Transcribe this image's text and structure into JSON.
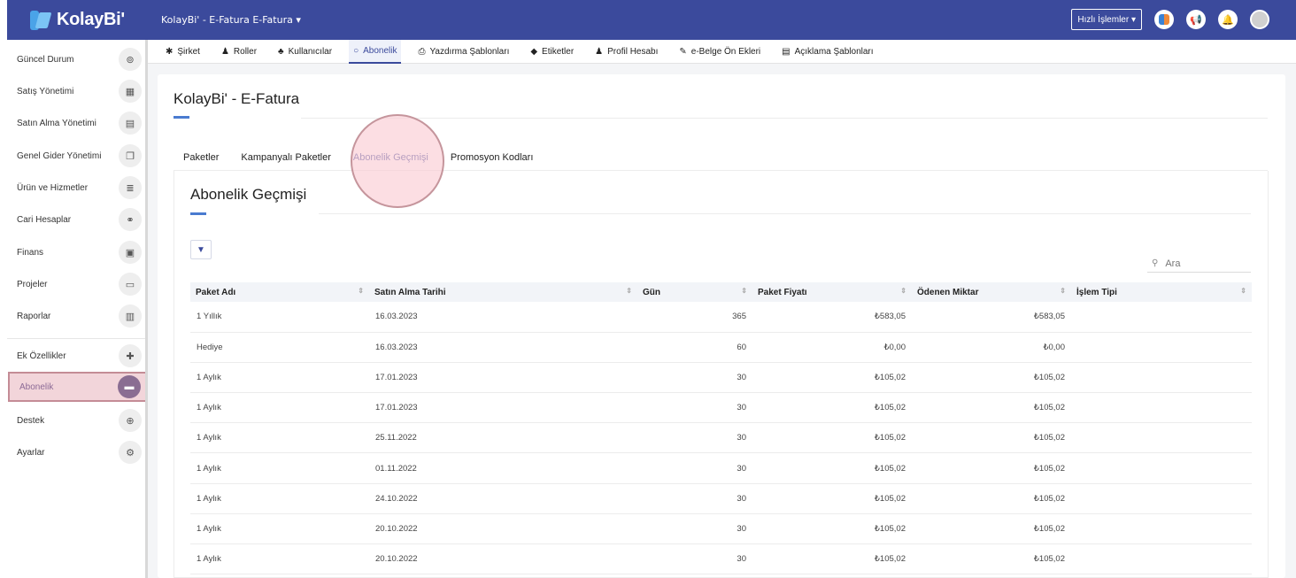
{
  "topbar": {
    "logo_text": "KolayBi'",
    "company_selector": "KolayBi' - E-Fatura E-Fatura ▾",
    "quick_actions_label": "Hızlı İşlemler ▾"
  },
  "sidebar": {
    "items": [
      {
        "label": "Güncel Durum",
        "icon": "dashboard-icon",
        "glyph": "⊚"
      },
      {
        "label": "Satış Yönetimi",
        "icon": "calculator-icon",
        "glyph": "▦"
      },
      {
        "label": "Satın Alma Yönetimi",
        "icon": "document-icon",
        "glyph": "▤"
      },
      {
        "label": "Genel Gider Yönetimi",
        "icon": "copy-icon",
        "glyph": "❐"
      },
      {
        "label": "Ürün ve Hizmetler",
        "icon": "database-icon",
        "glyph": "≣"
      },
      {
        "label": "Cari Hesaplar",
        "icon": "handshake-icon",
        "glyph": "⚭"
      },
      {
        "label": "Finans",
        "icon": "money-icon",
        "glyph": "▣"
      },
      {
        "label": "Projeler",
        "icon": "folder-icon",
        "glyph": "▭"
      },
      {
        "label": "Raporlar",
        "icon": "bar-chart-icon",
        "glyph": "▥"
      },
      {
        "label": "Ek Özellikler",
        "icon": "puzzle-icon",
        "glyph": "✚"
      },
      {
        "label": "Abonelik",
        "icon": "credit-card-icon",
        "glyph": "▬"
      },
      {
        "label": "Destek",
        "icon": "lifebuoy-icon",
        "glyph": "⊕"
      },
      {
        "label": "Ayarlar",
        "icon": "cogs-icon",
        "glyph": "⚙"
      }
    ],
    "active_index": 10
  },
  "subnav": {
    "items": [
      {
        "label": "Şirket",
        "icon": "gear-icon",
        "glyph": "✱"
      },
      {
        "label": "Roller",
        "icon": "user-lock-icon",
        "glyph": "♟"
      },
      {
        "label": "Kullanıcılar",
        "icon": "users-icon",
        "glyph": "♣"
      },
      {
        "label": "Abonelik",
        "icon": "circle-notch-icon",
        "glyph": "○"
      },
      {
        "label": "Yazdırma Şablonları",
        "icon": "print-icon",
        "glyph": "⎙"
      },
      {
        "label": "Etiketler",
        "icon": "tags-icon",
        "glyph": "◆"
      },
      {
        "label": "Profil Hesabı",
        "icon": "user-icon",
        "glyph": "♟"
      },
      {
        "label": "e-Belge Ön Ekleri",
        "icon": "edit-icon",
        "glyph": "✎"
      },
      {
        "label": "Açıklama Şablonları",
        "icon": "list-alt-icon",
        "glyph": "▤"
      }
    ],
    "active_index": 3
  },
  "page": {
    "title": "KolayBi' - E-Fatura",
    "tabs": [
      "Paketler",
      "Kampanyalı Paketler",
      "Abonelik Geçmişi",
      "Promosyon Kodları"
    ],
    "active_tab": 2,
    "panel_title": "Abonelik Geçmişi",
    "search_placeholder": "Ara"
  },
  "table": {
    "headers": [
      "Paket Adı",
      "Satın Alma Tarihi",
      "Gün",
      "Paket Fiyatı",
      "Ödenen Miktar",
      "İşlem Tipi"
    ],
    "rows": [
      [
        "1 Yıllık",
        "16.03.2023",
        "365",
        "₺583,05",
        "₺583,05",
        ""
      ],
      [
        "Hediye",
        "16.03.2023",
        "60",
        "₺0,00",
        "₺0,00",
        ""
      ],
      [
        "1 Aylık",
        "17.01.2023",
        "30",
        "₺105,02",
        "₺105,02",
        ""
      ],
      [
        "1 Aylık",
        "17.01.2023",
        "30",
        "₺105,02",
        "₺105,02",
        ""
      ],
      [
        "1 Aylık",
        "25.11.2022",
        "30",
        "₺105,02",
        "₺105,02",
        ""
      ],
      [
        "1 Aylık",
        "01.11.2022",
        "30",
        "₺105,02",
        "₺105,02",
        ""
      ],
      [
        "1 Aylık",
        "24.10.2022",
        "30",
        "₺105,02",
        "₺105,02",
        ""
      ],
      [
        "1 Aylık",
        "20.10.2022",
        "30",
        "₺105,02",
        "₺105,02",
        ""
      ],
      [
        "1 Aylık",
        "20.10.2022",
        "30",
        "₺105,02",
        "₺105,02",
        ""
      ]
    ]
  },
  "colors": {
    "brand": "#3b4a9c",
    "accent": "#4a7bd0",
    "highlight": "#f2d5da"
  }
}
